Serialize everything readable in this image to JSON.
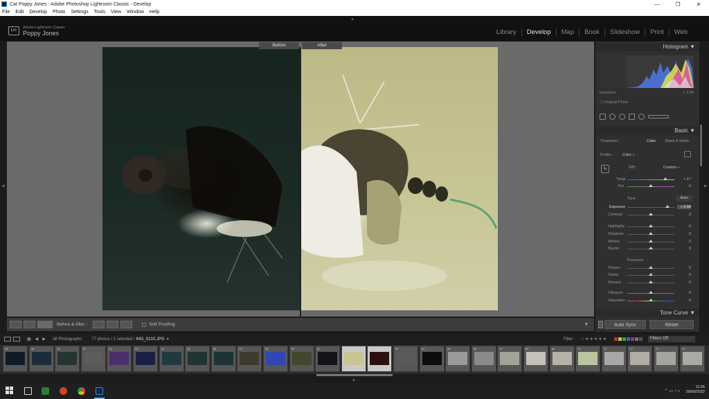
{
  "window": {
    "title": "Cat Poppy Jones - Adobe Photoshop Lightroom Classic - Develop",
    "controls": [
      "—",
      "❐",
      "✕"
    ]
  },
  "menu": [
    "File",
    "Edit",
    "Develop",
    "Photo",
    "Settings",
    "Tools",
    "View",
    "Window",
    "Help"
  ],
  "identity": {
    "badge": "Lrc",
    "app_name": "Adobe Lightroom Classic",
    "user": "Poppy Jones"
  },
  "modules": [
    "Library",
    "Develop",
    "Map",
    "Book",
    "Slideshow",
    "Print",
    "Web"
  ],
  "active_module": "Develop",
  "compare": {
    "before_label": "Before",
    "after_label": "After"
  },
  "toolbar": {
    "before_after_label": "Before & After :",
    "soft_proofing_label": "Soft Proofing"
  },
  "right_panel": {
    "histogram": {
      "title": "Histogram",
      "exposure_label": "Exposure",
      "exposure_value": "+ 3.68",
      "original_photo_label": "Original Photo"
    },
    "basic": {
      "title": "Basic",
      "treatment_label": "Treatment :",
      "treatment_color": "Color",
      "treatment_bw": "Black & White",
      "profile_label": "Profile :",
      "profile_value": "Color ÷",
      "wb_label": "WB :",
      "wb_value": "Custom ÷",
      "temp": {
        "label": "Temp",
        "value": "+ 67"
      },
      "tint": {
        "label": "Tint",
        "value": "0"
      },
      "tone_label": "Tone",
      "auto_label": "Auto",
      "tone_sliders": [
        {
          "label": "Exposure",
          "value": "+ 3.68",
          "highlighted": true
        },
        {
          "label": "Contrast",
          "value": "0"
        },
        {
          "label": "Highlights",
          "value": "0"
        },
        {
          "label": "Shadows",
          "value": "0"
        },
        {
          "label": "Whites",
          "value": "0"
        },
        {
          "label": "Blacks",
          "value": "0"
        }
      ],
      "presence_label": "Presence",
      "presence_sliders": [
        {
          "label": "Texture",
          "value": "0"
        },
        {
          "label": "Clarity",
          "value": "0"
        },
        {
          "label": "Dehaze",
          "value": "0"
        },
        {
          "label": "Vibrance",
          "value": "0"
        },
        {
          "label": "Saturation",
          "value": "0"
        }
      ]
    },
    "tone_curve_title": "Tone Curve",
    "auto_sync_label": "Auto Sync",
    "reset_label": "Reset"
  },
  "filmstrip_bar": {
    "source": "All Photographs",
    "count": "77 photos / 2 selected /",
    "filename": "IMG_9210.JPG",
    "filter_label": "Filter :",
    "filters_off": "Filters Off"
  },
  "filmstrip": [
    {
      "num": "48",
      "color": "#101b2a",
      "selected": false
    },
    {
      "num": "49",
      "color": "#1d2c3a",
      "selected": false
    },
    {
      "num": "50",
      "color": "#24372e",
      "selected": false
    },
    {
      "num": "51",
      "color": "#5c5c5c",
      "selected": false
    },
    {
      "num": "52",
      "color": "#4b2e6c",
      "selected": false
    },
    {
      "num": "53",
      "color": "#1c1f45",
      "selected": false
    },
    {
      "num": "54",
      "color": "#1f3b40",
      "selected": false
    },
    {
      "num": "55",
      "color": "#213332",
      "selected": false
    },
    {
      "num": "56",
      "color": "#1d3437",
      "selected": false
    },
    {
      "num": "57",
      "color": "#3e3a2f",
      "selected": false
    },
    {
      "num": "58",
      "color": "#3247b5",
      "selected": false
    },
    {
      "num": "59",
      "color": "#44462e",
      "selected": false
    },
    {
      "num": "60",
      "color": "#141418",
      "selected": false
    },
    {
      "num": "61",
      "color": "#c9c493",
      "selected": true
    },
    {
      "num": "62",
      "color": "#2b1010",
      "selected": true
    },
    {
      "num": "63",
      "color": "#5a5a5a",
      "selected": false
    },
    {
      "num": "64",
      "color": "#0d0d0d",
      "selected": false
    },
    {
      "num": "65",
      "color": "#9a9a9a",
      "selected": false
    },
    {
      "num": "66",
      "color": "#8a8a8a",
      "selected": false
    },
    {
      "num": "67",
      "color": "#a3a39a",
      "selected": false
    },
    {
      "num": "68",
      "color": "#c4c1b7",
      "selected": false
    },
    {
      "num": "69",
      "color": "#b7b2a8",
      "selected": false
    },
    {
      "num": "70",
      "color": "#b9c59c",
      "selected": false
    },
    {
      "num": "71",
      "color": "#a8a8a8",
      "selected": false
    },
    {
      "num": "72",
      "color": "#b0ada6",
      "selected": false
    },
    {
      "num": "73",
      "color": "#a6a49f",
      "selected": false
    },
    {
      "num": "74",
      "color": "#aba9a3",
      "selected": false
    }
  ],
  "taskbar": {
    "time": "11:55",
    "date": "29/09/2022"
  }
}
